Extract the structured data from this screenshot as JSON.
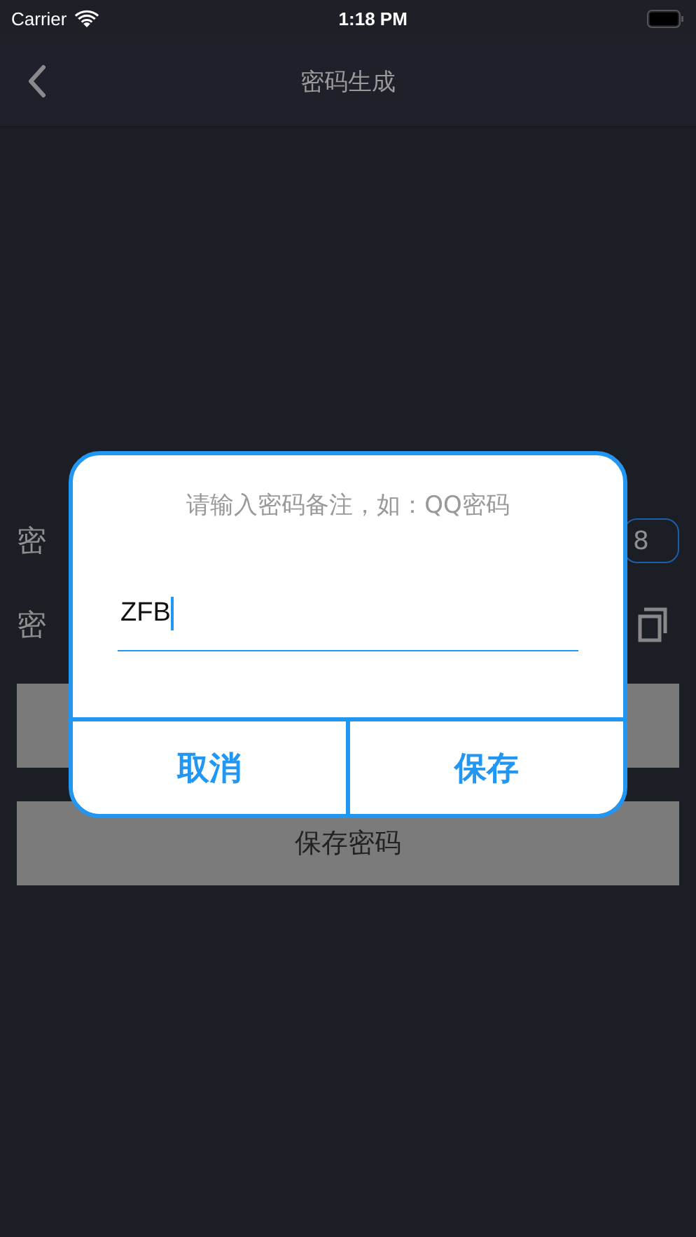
{
  "status_bar": {
    "carrier": "Carrier",
    "time": "1:18 PM"
  },
  "nav": {
    "title": "密码生成"
  },
  "rows": [
    {
      "label": "密",
      "kind": "field",
      "value": "8"
    },
    {
      "label": "密",
      "kind": "copy"
    }
  ],
  "buttons": [
    {
      "label": "保存密码"
    }
  ],
  "dialog": {
    "message": "请输入密码备注，如：QQ密码",
    "input": {
      "value": "ZFB",
      "focused": true
    },
    "actions": [
      {
        "label": "取消"
      },
      {
        "label": "保存"
      }
    ]
  }
}
